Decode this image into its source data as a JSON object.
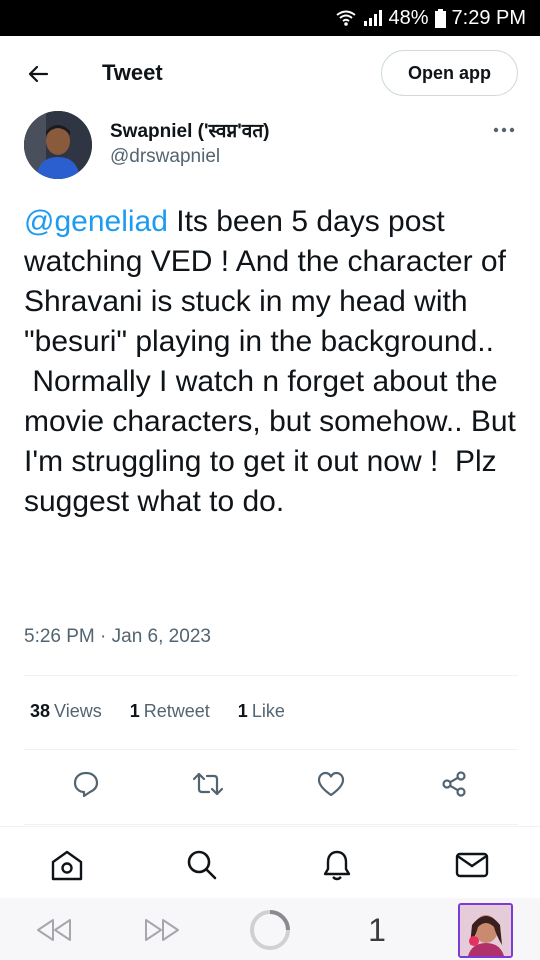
{
  "status_bar": {
    "battery": "48%",
    "time": "7:29 PM"
  },
  "header": {
    "title": "Tweet",
    "open_app_label": "Open app"
  },
  "tweet": {
    "author_name": "Swapniel ('स्वप्न'वत)",
    "author_handle": "@drswapniel",
    "mention": "@geneliad",
    "text": " Its been 5 days post watching VED ! And the character of Shravani is stuck in my head with \"besuri\" playing in the background..\n Normally I watch n forget about the movie characters, but somehow.. But I'm struggling to get it out now !  Plz suggest what to do.",
    "timestamp": "5:26 PM · Jan 6, 2023"
  },
  "stats": {
    "views_count": "38",
    "views_label": "Views",
    "retweets_count": "1",
    "retweets_label": "Retweet",
    "likes_count": "1",
    "likes_label": "Like"
  },
  "actions": [
    "reply-icon",
    "retweet-icon",
    "like-icon",
    "share-icon"
  ],
  "bottom_nav": [
    "home-icon",
    "search-icon",
    "notifications-icon",
    "messages-icon"
  ],
  "browser": {
    "tab_count": "1"
  },
  "colors": {
    "accent": "#1d9bf0",
    "text": "#0f1419",
    "secondary": "#536471",
    "border": "#eff3f4"
  }
}
